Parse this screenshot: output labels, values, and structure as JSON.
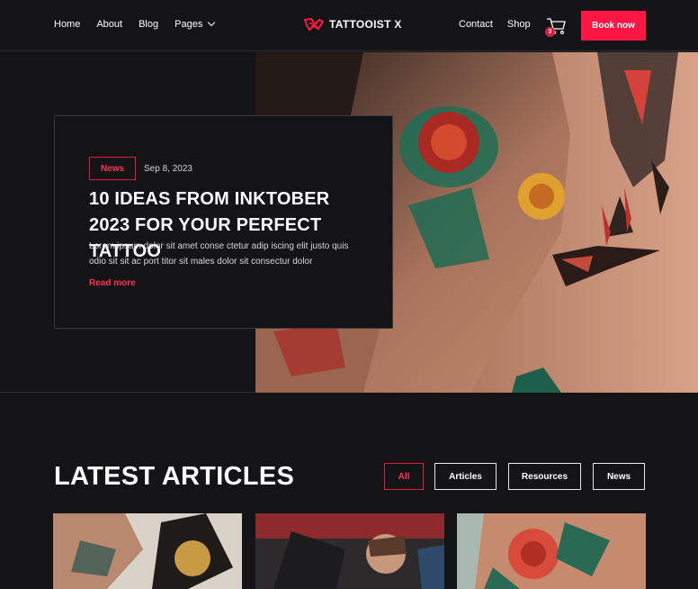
{
  "header": {
    "nav_left": [
      "Home",
      "About",
      "Blog",
      "Pages"
    ],
    "logo_text": "TATTOOIST X",
    "nav_right": [
      "Contact",
      "Shop"
    ],
    "cart_count": "3",
    "book_button": "Book now"
  },
  "hero": {
    "tag": "News",
    "date": "Sep 8, 2023",
    "title": "10 IDEAS FROM INKTOBER 2023 FOR YOUR PERFECT TATTOO",
    "text": "Lorem ipsum dolor sit amet conse ctetur adip iscing elit justo quis odio sit sit ac port titor sit males dolor sit consectur dolor",
    "read_more": "Read more"
  },
  "articles": {
    "title": "LATEST ARTICLES",
    "filters": [
      "All",
      "Articles",
      "Resources",
      "News"
    ],
    "active_filter": "All"
  },
  "colors": {
    "accent": "#ff1744",
    "background": "#141416"
  }
}
